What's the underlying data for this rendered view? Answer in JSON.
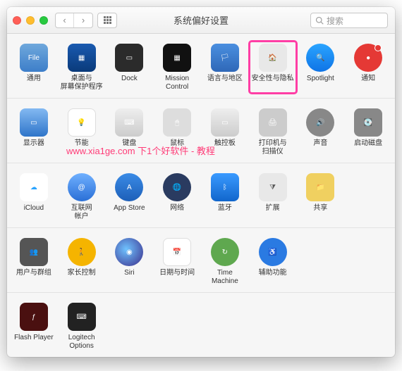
{
  "window": {
    "title": "系统偏好设置"
  },
  "search": {
    "placeholder": "搜索"
  },
  "watermark": "www.xia1ge.com  下1个好软件 - 教程",
  "highlighted": "security",
  "rows": [
    {
      "items": [
        {
          "id": "general",
          "label": "通用"
        },
        {
          "id": "desktop",
          "label": "桌面与\n屏幕保护程序"
        },
        {
          "id": "dock",
          "label": "Dock"
        },
        {
          "id": "mission",
          "label": "Mission\nControl"
        },
        {
          "id": "lang",
          "label": "语言与地区"
        },
        {
          "id": "security",
          "label": "安全性与隐私"
        },
        {
          "id": "spotlight",
          "label": "Spotlight"
        },
        {
          "id": "notif",
          "label": "通知",
          "badge": true
        }
      ]
    },
    {
      "items": [
        {
          "id": "display",
          "label": "显示器"
        },
        {
          "id": "energy",
          "label": "节能"
        },
        {
          "id": "keyboard",
          "label": "键盘"
        },
        {
          "id": "mouse",
          "label": "鼠标"
        },
        {
          "id": "trackpad",
          "label": "触控板"
        },
        {
          "id": "printer",
          "label": "打印机与\n扫描仪"
        },
        {
          "id": "sound",
          "label": "声音"
        },
        {
          "id": "startup",
          "label": "启动磁盘"
        }
      ]
    },
    {
      "items": [
        {
          "id": "icloud",
          "label": "iCloud"
        },
        {
          "id": "internet",
          "label": "互联网\n帐户"
        },
        {
          "id": "appstore",
          "label": "App Store"
        },
        {
          "id": "network",
          "label": "网络"
        },
        {
          "id": "bt",
          "label": "蓝牙"
        },
        {
          "id": "ext",
          "label": "扩展"
        },
        {
          "id": "share",
          "label": "共享"
        }
      ]
    },
    {
      "items": [
        {
          "id": "users",
          "label": "用户与群组"
        },
        {
          "id": "parental",
          "label": "家长控制"
        },
        {
          "id": "siri",
          "label": "Siri"
        },
        {
          "id": "date",
          "label": "日期与时间"
        },
        {
          "id": "tm",
          "label": "Time Machine"
        },
        {
          "id": "access",
          "label": "辅助功能"
        }
      ]
    },
    {
      "items": [
        {
          "id": "flash",
          "label": "Flash Player"
        },
        {
          "id": "logi",
          "label": "Logitech Options"
        }
      ]
    }
  ],
  "icons": {
    "general": "File",
    "desktop": "▦",
    "dock": "▭",
    "mission": "▦",
    "lang": "🏳",
    "security": "🏠",
    "spotlight": "🔍",
    "notif": "●",
    "display": "▭",
    "energy": "💡",
    "keyboard": "⌨",
    "mouse": "🖱",
    "trackpad": "▭",
    "printer": "🖨",
    "sound": "🔊",
    "startup": "💽",
    "icloud": "☁",
    "internet": "@",
    "appstore": "A",
    "network": "🌐",
    "bt": "ᛒ",
    "ext": "⧩",
    "share": "📁",
    "users": "👥",
    "parental": "🚶",
    "siri": "◉",
    "date": "📅",
    "tm": "↻",
    "access": "♿",
    "flash": "ƒ",
    "logi": "⌨"
  }
}
